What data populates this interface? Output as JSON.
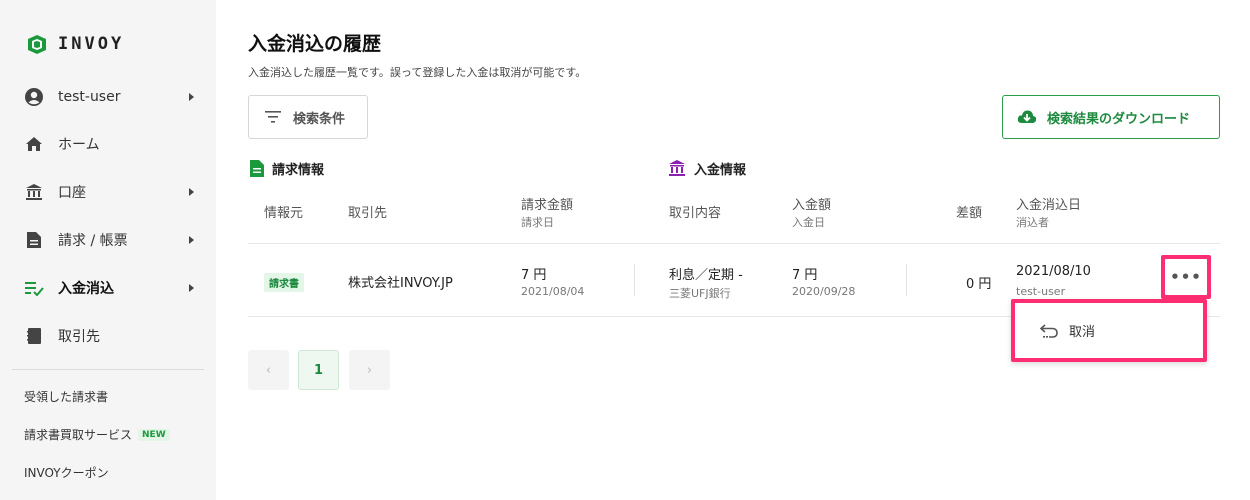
{
  "brand": {
    "name": "INVOY",
    "color": "#1a9a3c"
  },
  "sidebar": {
    "items": [
      {
        "label": "test-user",
        "icon": "account-circle-icon",
        "has_caret": true
      },
      {
        "label": "ホーム",
        "icon": "home-icon",
        "has_caret": false
      },
      {
        "label": "口座",
        "icon": "bank-icon",
        "has_caret": true
      },
      {
        "label": "請求 / 帳票",
        "icon": "document-icon",
        "has_caret": true
      },
      {
        "label": "入金消込",
        "icon": "list-check-icon",
        "has_caret": true,
        "active": true
      },
      {
        "label": "取引先",
        "icon": "address-book-icon",
        "has_caret": false
      }
    ],
    "links": [
      {
        "label": "受領した請求書"
      },
      {
        "label": "請求書買取サービス",
        "badge": "NEW"
      },
      {
        "label": "INVOYクーポン"
      }
    ]
  },
  "page": {
    "title": "入金消込の履歴",
    "description": "入金消込した履歴一覧です。誤って登録した入金は取消が可能です。"
  },
  "toolbar": {
    "search_label": "検索条件",
    "download_label": "検索結果のダウンロード"
  },
  "sections": {
    "invoice": "請求情報",
    "payment": "入金情報"
  },
  "columns": {
    "source": "情報元",
    "client": "取引先",
    "invoice_amount": "請求金額",
    "invoice_date": "請求日",
    "transaction": "取引内容",
    "payment_amount": "入金額",
    "payment_date": "入金日",
    "difference": "差額",
    "reconcile_date": "入金消込日",
    "reconciler": "消込者"
  },
  "rows": [
    {
      "source_badge": "請求書",
      "client": "株式会社INVOY.JP",
      "invoice_amount": "7 円",
      "invoice_date": "2021/08/04",
      "transaction": "利息／定期 -",
      "bank": "三菱UFJ銀行",
      "payment_amount": "7 円",
      "payment_date": "2020/09/28",
      "difference": "0 円",
      "reconcile_date": "2021/08/10",
      "reconciler": "test-user"
    }
  ],
  "row_menu": {
    "more_label": "•••",
    "cancel_label": "取消"
  },
  "pagination": {
    "prev": "‹",
    "current": "1",
    "next": "›"
  },
  "colors": {
    "accent": "#1a9a3c",
    "highlight": "#ff2e72",
    "payment_icon": "#8a1fb0"
  }
}
